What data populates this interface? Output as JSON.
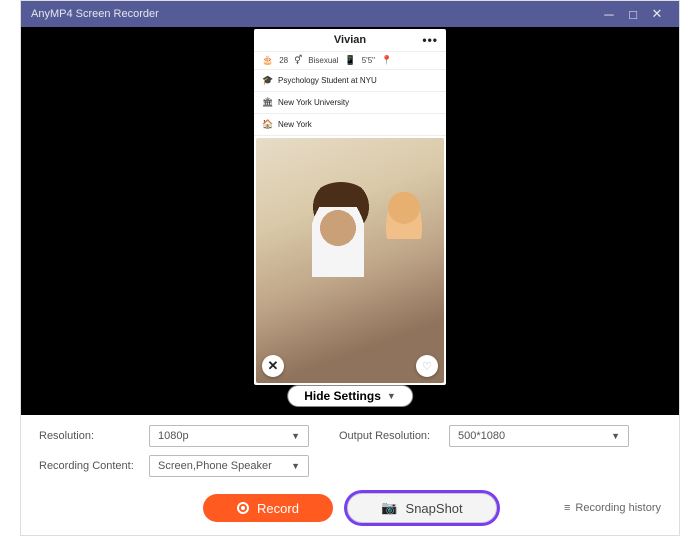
{
  "titlebar": {
    "app_name": "AnyMP4 Screen Recorder"
  },
  "phone": {
    "name": "Vivian",
    "more": "•••",
    "age": "28",
    "orientation": "Bisexual",
    "height": "5'5\"",
    "rows": [
      {
        "icon": "🎓",
        "text": "Psychology Student at NYU"
      },
      {
        "icon": "🏛",
        "text": "New York University"
      },
      {
        "icon": "🏠",
        "text": "New York"
      }
    ]
  },
  "hide_settings": {
    "label": "Hide Settings"
  },
  "settings": {
    "resolution_label": "Resolution:",
    "resolution_value": "1080p",
    "output_label": "Output Resolution:",
    "output_value": "500*1080",
    "content_label": "Recording Content:",
    "content_value": "Screen,Phone Speaker"
  },
  "buttons": {
    "record": "Record",
    "snapshot": "SnapShot",
    "history": "Recording history"
  }
}
